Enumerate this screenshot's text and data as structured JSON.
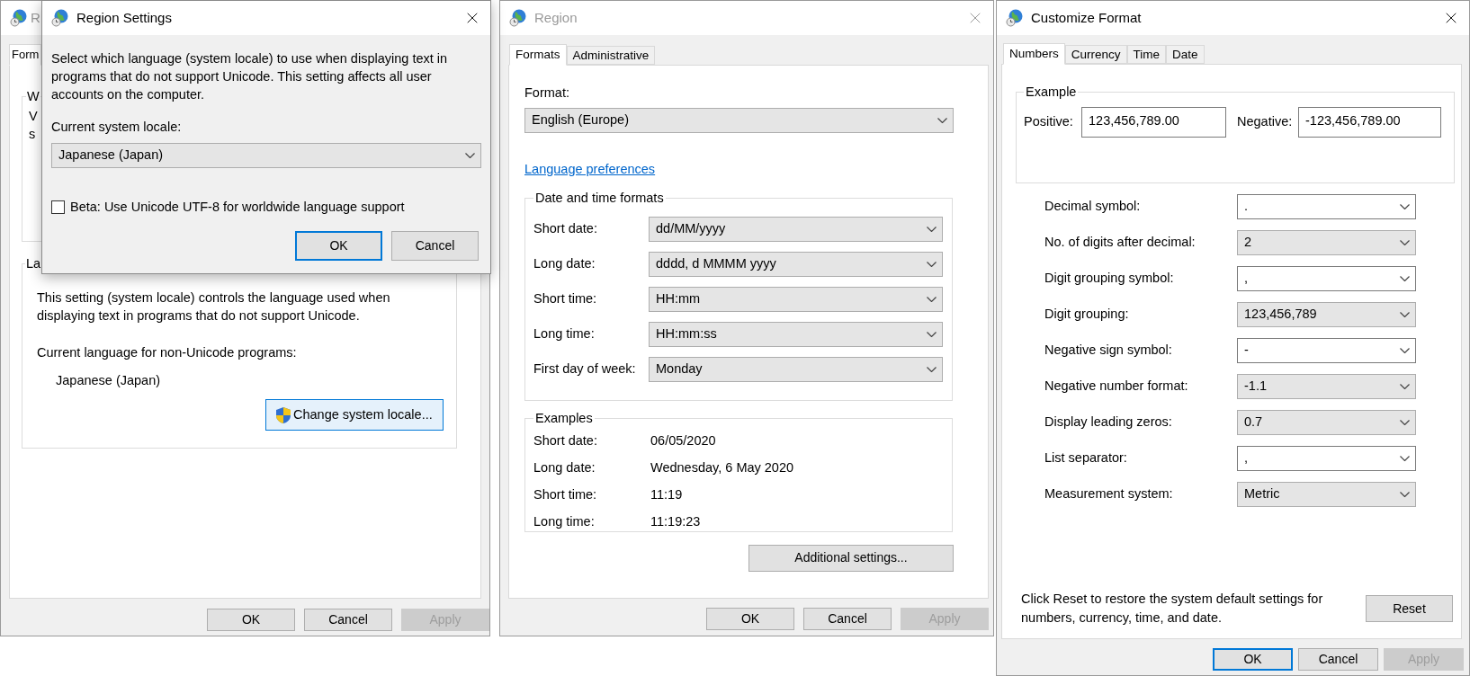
{
  "back_window": {
    "active": false,
    "title": "R",
    "tabs": [
      {
        "label": "Form",
        "selected": true
      }
    ],
    "first_group": {
      "title": "W",
      "lines": [
        "V",
        "s"
      ]
    },
    "language_group": {
      "title": "La",
      "description": "This setting (system locale) controls the language used when displaying text in programs that do not support Unicode.",
      "current_label": "Current language for non-Unicode programs:",
      "current_value": "Japanese (Japan)",
      "change_button": {
        "label": "Change system locale...",
        "focused": true
      }
    },
    "buttons": [
      {
        "label": "OK",
        "disabled": false,
        "focused": false
      },
      {
        "label": "Cancel",
        "disabled": false,
        "focused": false
      },
      {
        "label": "Apply",
        "disabled": true,
        "focused": false
      }
    ]
  },
  "locale_dialog": {
    "active": true,
    "title": "Region Settings",
    "description": "Select which language (system locale) to use when displaying text in programs that do not support Unicode. This setting affects all user accounts on the computer.",
    "locale_label": "Current system locale:",
    "locale_value": "Japanese (Japan)",
    "beta_checkbox": {
      "label": "Beta: Use Unicode UTF-8 for worldwide language support",
      "checked": false
    },
    "buttons": [
      {
        "label": "OK",
        "disabled": false,
        "focused": true
      },
      {
        "label": "Cancel",
        "disabled": false,
        "focused": false
      }
    ]
  },
  "region_window": {
    "active": false,
    "title": "Region",
    "tabs": [
      {
        "label": "Formats",
        "selected": true
      },
      {
        "label": "Administrative",
        "selected": false
      }
    ],
    "format_label": "Format:",
    "format_value": "English (Europe)",
    "link": "Language preferences",
    "date_time_group": {
      "title": "Date and time formats",
      "rows": [
        {
          "label": "Short date:",
          "value": "dd/MM/yyyy"
        },
        {
          "label": "Long date:",
          "value": "dddd, d MMMM yyyy"
        },
        {
          "label": "Short time:",
          "value": "HH:mm"
        },
        {
          "label": "Long time:",
          "value": "HH:mm:ss"
        },
        {
          "label": "First day of week:",
          "value": "Monday"
        }
      ]
    },
    "examples_group": {
      "title": "Examples",
      "rows": [
        {
          "label": "Short date:",
          "value": "06/05/2020"
        },
        {
          "label": "Long date:",
          "value": "Wednesday, 6 May 2020"
        },
        {
          "label": "Short time:",
          "value": "11:19"
        },
        {
          "label": "Long time:",
          "value": "11:19:23"
        }
      ]
    },
    "additional_button": {
      "label": "Additional settings...",
      "disabled": false,
      "focused": false
    },
    "buttons": [
      {
        "label": "OK",
        "disabled": false,
        "focused": false
      },
      {
        "label": "Cancel",
        "disabled": false,
        "focused": false
      },
      {
        "label": "Apply",
        "disabled": true,
        "focused": false
      }
    ]
  },
  "customize_window": {
    "active": true,
    "title": "Customize Format",
    "tabs": [
      {
        "label": "Numbers",
        "selected": true
      },
      {
        "label": "Currency",
        "selected": false
      },
      {
        "label": "Time",
        "selected": false
      },
      {
        "label": "Date",
        "selected": false
      }
    ],
    "example_group": {
      "title": "Example",
      "positive_label": "Positive:",
      "positive_value": "123,456,789.00",
      "negative_label": "Negative:",
      "negative_value": "-123,456,789.00"
    },
    "settings": [
      {
        "label": "Decimal symbol:",
        "value": ".",
        "kind": "editable"
      },
      {
        "label": "No. of digits after decimal:",
        "value": "2",
        "kind": "list"
      },
      {
        "label": "Digit grouping symbol:",
        "value": ",",
        "kind": "editable"
      },
      {
        "label": "Digit grouping:",
        "value": "123,456,789",
        "kind": "list"
      },
      {
        "label": "Negative sign symbol:",
        "value": "-",
        "kind": "editable"
      },
      {
        "label": "Negative number format:",
        "value": "-1.1",
        "kind": "list"
      },
      {
        "label": "Display leading zeros:",
        "value": "0.7",
        "kind": "list"
      },
      {
        "label": "List separator:",
        "value": ",",
        "kind": "editable"
      },
      {
        "label": "Measurement system:",
        "value": "Metric",
        "kind": "list"
      }
    ],
    "reset_note": "Click Reset to restore the system default settings for numbers, currency, time, and date.",
    "reset_button": {
      "label": "Reset",
      "disabled": false,
      "focused": false
    },
    "buttons": [
      {
        "label": "OK",
        "disabled": false,
        "focused": true
      },
      {
        "label": "Cancel",
        "disabled": false,
        "focused": false
      },
      {
        "label": "Apply",
        "disabled": true,
        "focused": false
      }
    ]
  }
}
